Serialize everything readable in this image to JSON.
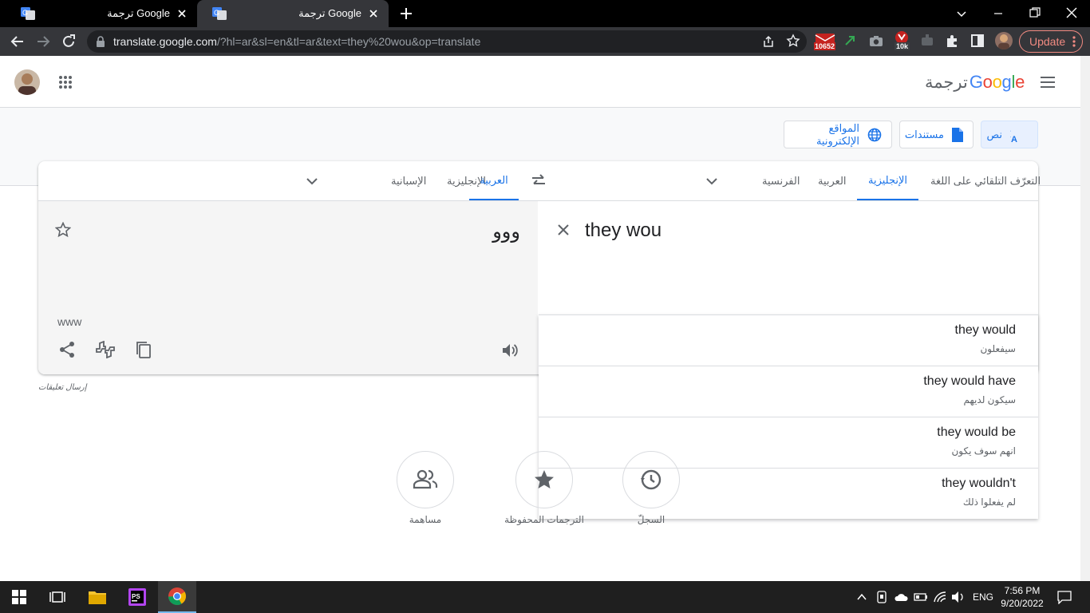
{
  "browser": {
    "tabs": [
      {
        "title": "Google ترجمة",
        "active": false
      },
      {
        "title": "Google ترجمة",
        "active": true
      }
    ],
    "url_domain": "translate.google.com",
    "url_path": "/?hl=ar&sl=en&tl=ar&text=they%20wou&op=translate",
    "extension_badges": {
      "mail": "10652",
      "yt": "10k"
    },
    "update_label": "Update"
  },
  "header": {
    "logo_google": "Google",
    "logo_suffix": "ترجمة"
  },
  "modes": {
    "text": "نص",
    "documents": "مستندات",
    "websites": "المواقع الإلكترونية"
  },
  "source_langs": [
    "التعرّف التلقائي على اللغة",
    "الإنجليزية",
    "العربية",
    "الفرنسية"
  ],
  "source_selected": "الإنجليزية",
  "target_langs": [
    "العربية",
    "الإنجليزية",
    "الإسبانية"
  ],
  "target_selected": "العربية",
  "input_text": "they wou",
  "output_text": "ووو",
  "transliteration": "www",
  "suggestions": [
    {
      "en": "they would",
      "ar": "سيفعلون"
    },
    {
      "en": "they would have",
      "ar": "سيكون لديهم"
    },
    {
      "en": "they would be",
      "ar": "انهم سوف يكون"
    },
    {
      "en": "they wouldn't",
      "ar": "لم يفعلوا ذلك"
    }
  ],
  "feedback_label": "إرسال تعليقات",
  "bottom": {
    "history": "السجلّ",
    "saved": "الترجمات المحفوظة",
    "contribute": "مساهمة"
  },
  "taskbar": {
    "language": "ENG",
    "time": "7:56 PM",
    "date": "9/20/2022"
  }
}
